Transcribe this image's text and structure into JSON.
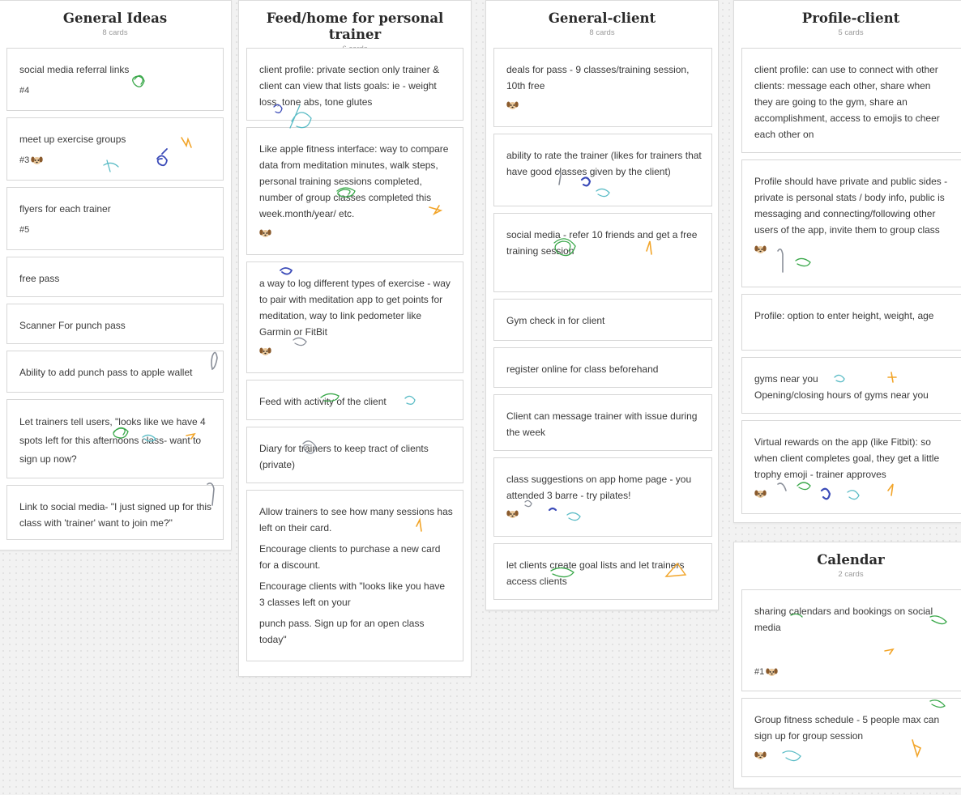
{
  "columns": [
    {
      "title": "General Ideas",
      "count": "8 cards",
      "cards": [
        {
          "text": "social media referral links",
          "tag": "#4"
        },
        {
          "text": "meet up exercise groups",
          "tag": "#3",
          "emoji": "dog"
        },
        {
          "text": "flyers for each trainer",
          "tag": "#5"
        },
        {
          "text": "free pass"
        },
        {
          "text": "Scanner For punch pass"
        },
        {
          "text": "Ability to add punch pass to apple wallet"
        },
        {
          "text": "Let trainers tell users, \"looks like we have 4 spots left for this afternoons class- want to sign up now?"
        },
        {
          "text": "Link to social media- \"I just signed up for this class with 'trainer' want to join me?\""
        }
      ]
    },
    {
      "title": "Feed/home for personal trainer",
      "count": "6 cards",
      "cards": [
        {
          "text": "client profile: private section only trainer & client can view that lists goals: ie - weight loss, tone  abs, tone glutes"
        },
        {
          "text": "Like apple fitness interface: way to compare data from meditation minutes, walk steps, personal training sessions completed, number of group classes completed this week.month/year/ etc.",
          "emoji": "dog"
        },
        {
          "text": "a way to log different types of  exercise - way to pair with meditation app to get points for meditation, way to link pedometer like Garmin or FitBit",
          "emoji": "dog"
        },
        {
          "text": "Feed with activity of the client"
        },
        {
          "text": "Diary for trainers to keep tract of clients (private)"
        },
        {
          "paragraphs": [
            "Allow trainers to see how many sessions has left on their card.",
            "Encourage clients to purchase a new card for a discount.",
            "Encourage clients with \"looks like you have 3 classes left on your",
            "punch pass. Sign up for an open class today\""
          ]
        }
      ]
    },
    {
      "title": "General-client",
      "count": "8 cards",
      "cards": [
        {
          "text": "deals for pass - 9 classes/training session, 10th free",
          "emoji": "dog"
        },
        {
          "text": "ability to rate the trainer (likes for trainers that have good classes given by the client)"
        },
        {
          "text": "social media - refer 10 friends and get a free training session"
        },
        {
          "text": "Gym check in for client"
        },
        {
          "text": "register online for class beforehand"
        },
        {
          "text": "Client can message trainer with issue during the week"
        },
        {
          "text": "class suggestions on app home page - you attended 3 barre - try pilates!",
          "emoji": "dog"
        },
        {
          "text": "let clients create goal lists and let trainers access clients"
        }
      ]
    },
    {
      "title": "Profile-client",
      "count": "5 cards",
      "cards": [
        {
          "text": "client profile: can use to connect with other clients: message each other, share when they are going to the gym, share an accomplishment, access to emojis to cheer each other on"
        },
        {
          "text": "Profile should have private and public sides - private is personal stats / body info, public is messaging and connecting/following other users of the app, invite them to group class",
          "emoji": "dog"
        },
        {
          "text": "Profile: option to enter height, weight, age"
        },
        {
          "paragraphs": [
            "gyms near you",
            "Opening/closing hours of gyms near you"
          ]
        },
        {
          "text": "Virtual rewards on the app (like Fitbit): so when client completes goal, they get a little trophy emoji - trainer approves",
          "emoji": "dog"
        }
      ]
    },
    {
      "title": "Calendar",
      "count": "2 cards",
      "cards": [
        {
          "text": "sharing calendars and bookings on social media",
          "tag": "#1",
          "emoji": "dog"
        },
        {
          "text": "Group fitness schedule - 5 people max can sign up for group session",
          "emoji": "dog"
        }
      ]
    }
  ],
  "colors": {
    "scribble_green": "#3aa84a",
    "scribble_blue": "#3b4bb8",
    "scribble_teal": "#5bbcc6",
    "scribble_orange": "#f2a52a",
    "scribble_gray": "#8a8f99"
  }
}
